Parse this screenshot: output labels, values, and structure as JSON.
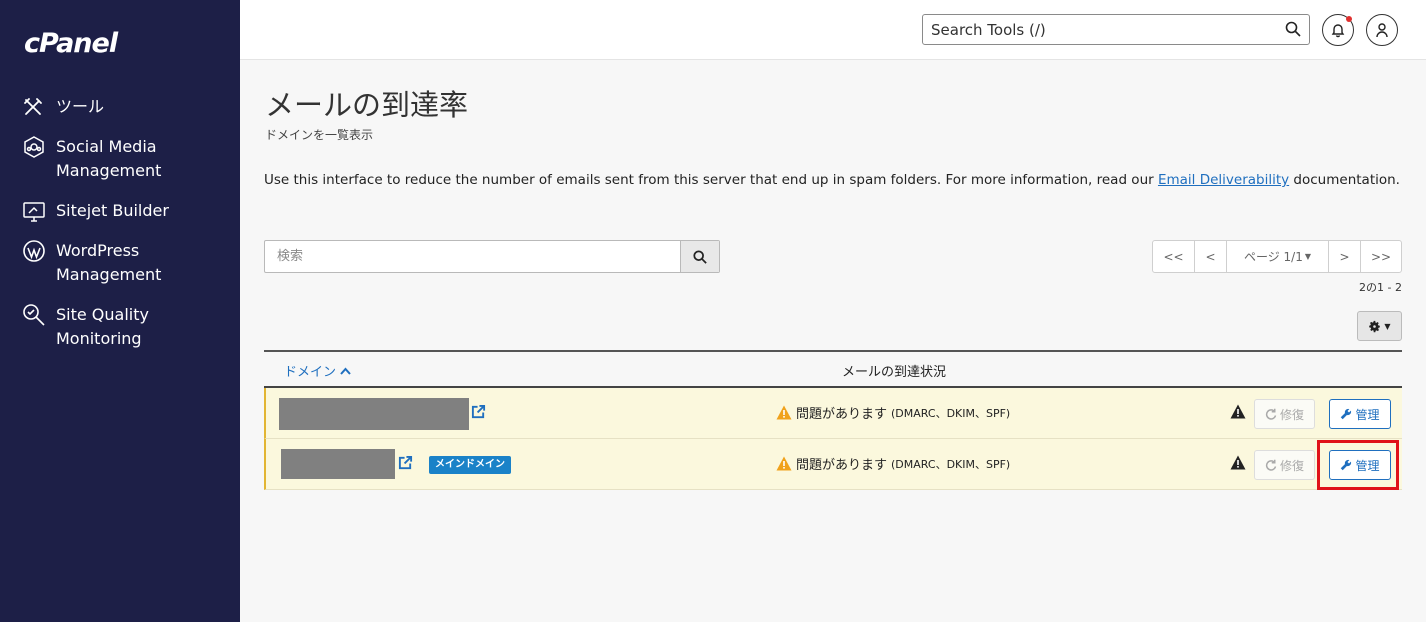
{
  "app": {
    "logo": "cPanel"
  },
  "sidebar": {
    "items": [
      {
        "label": "ツール",
        "icon": "tools-icon"
      },
      {
        "label": "Social Media Management",
        "icon": "social-media-icon"
      },
      {
        "label": "Sitejet Builder",
        "icon": "sitejet-icon"
      },
      {
        "label": "WordPress Management",
        "icon": "wordpress-icon"
      },
      {
        "label": "Site Quality Monitoring",
        "icon": "site-quality-icon"
      }
    ]
  },
  "header": {
    "search_placeholder": "Search Tools (/)"
  },
  "main": {
    "title": "メールの到達率",
    "subtitle": "ドメインを一覧表示",
    "description_before": "Use this interface to reduce the number of emails sent from this server that end up in spam folders. For more information, read our ",
    "description_link": "Email Deliverability",
    "description_after": " documentation.",
    "search_placeholder": "検索",
    "pager": {
      "first": "<<",
      "prev": "<",
      "page": "ページ 1/1",
      "next": ">",
      "last": ">>"
    },
    "range": "2の1 - 2",
    "table": {
      "col_domain": "ドメイン",
      "col_status": "メールの到達状況",
      "rows": [
        {
          "status": "問題があります",
          "status_detail": "(DMARC、DKIM、SPF)",
          "fix_label": "修復",
          "manage_label": "管理"
        },
        {
          "badge": "メインドメイン",
          "status": "問題があります",
          "status_detail": "(DMARC、DKIM、SPF)",
          "fix_label": "修復",
          "manage_label": "管理"
        }
      ]
    }
  },
  "colors": {
    "sidebar_bg": "#1d1f47",
    "link": "#1f6fbf",
    "warning": "#f0a21b",
    "row_bg": "#fbf8dd",
    "highlight": "#e0121a",
    "badge": "#1a82c8"
  }
}
